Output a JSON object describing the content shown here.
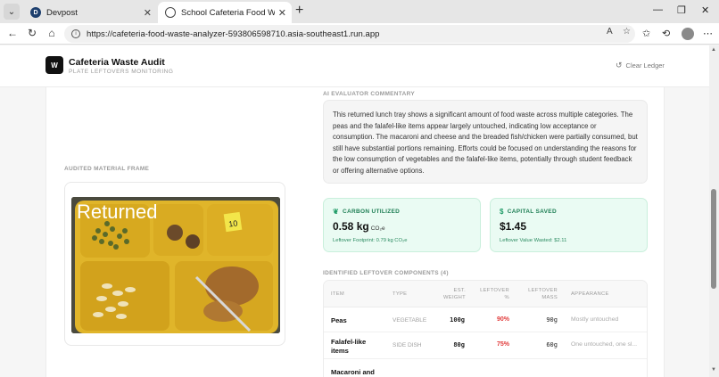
{
  "browser": {
    "tabs": [
      {
        "title": "Devpost",
        "favicon": "devpost-icon"
      },
      {
        "title": "School Cafeteria Food Waste Anal",
        "favicon": "globe-icon"
      }
    ],
    "url": "https://cafeteria-food-waste-analyzer-593806598710.asia-southeast1.run.app"
  },
  "header": {
    "logo": "W",
    "title": "Cafeteria Waste Audit",
    "subtitle": "PLATE LEFTOVERS MONITORING",
    "clear_label": "Clear Ledger"
  },
  "frame": {
    "label": "AUDITED MATERIAL FRAME",
    "overlay_text": "Returned",
    "tag_number": "10"
  },
  "commentary": {
    "label": "AI EVALUATOR COMMENTARY",
    "text": "This returned lunch tray shows a significant amount of food waste across multiple categories. The peas and the falafel-like items appear largely untouched, indicating low acceptance or consumption. The macaroni and cheese and the breaded fish/chicken were partially consumed, but still have substantial portions remaining. Efforts could be focused on understanding the reasons for the low consumption of vegetables and the falafel-like items, potentially through student feedback or offering alternative options."
  },
  "metrics": {
    "carbon": {
      "label": "CARBON UTILIZED",
      "value": "0.58 kg",
      "unit": "CO₂e",
      "sub": "Leftover Footprint: 0.79 kg CO₂e"
    },
    "capital": {
      "label": "CAPITAL SAVED",
      "value": "$1.45",
      "sub": "Leftover Value Wasted: $2.11"
    }
  },
  "components": {
    "label": "IDENTIFIED LEFTOVER COMPONENTS (4)",
    "columns": {
      "item": "ITEM",
      "type": "TYPE",
      "weight": "EST.\nWEIGHT",
      "pct": "LEFTOVER\n%",
      "mass": "LEFTOVER\nMASS",
      "appearance": "APPEARANCE"
    },
    "rows": [
      {
        "item": "Peas",
        "type": "VEGETABLE",
        "weight": "100g",
        "pct": "90%",
        "mass": "90g",
        "appearance": "Mostly untouched"
      },
      {
        "item": "Falafel-like items",
        "type": "SIDE DISH",
        "weight": "80g",
        "pct": "75%",
        "mass": "60g",
        "appearance": "One untouched, one sl..."
      },
      {
        "item": "Macaroni and",
        "type": "",
        "weight": "",
        "pct": "",
        "mass": "",
        "appearance": ""
      }
    ]
  },
  "colors": {
    "accent_green": "#1f9b67",
    "metric_bg": "#eafbf3",
    "danger": "#e13b3b"
  }
}
